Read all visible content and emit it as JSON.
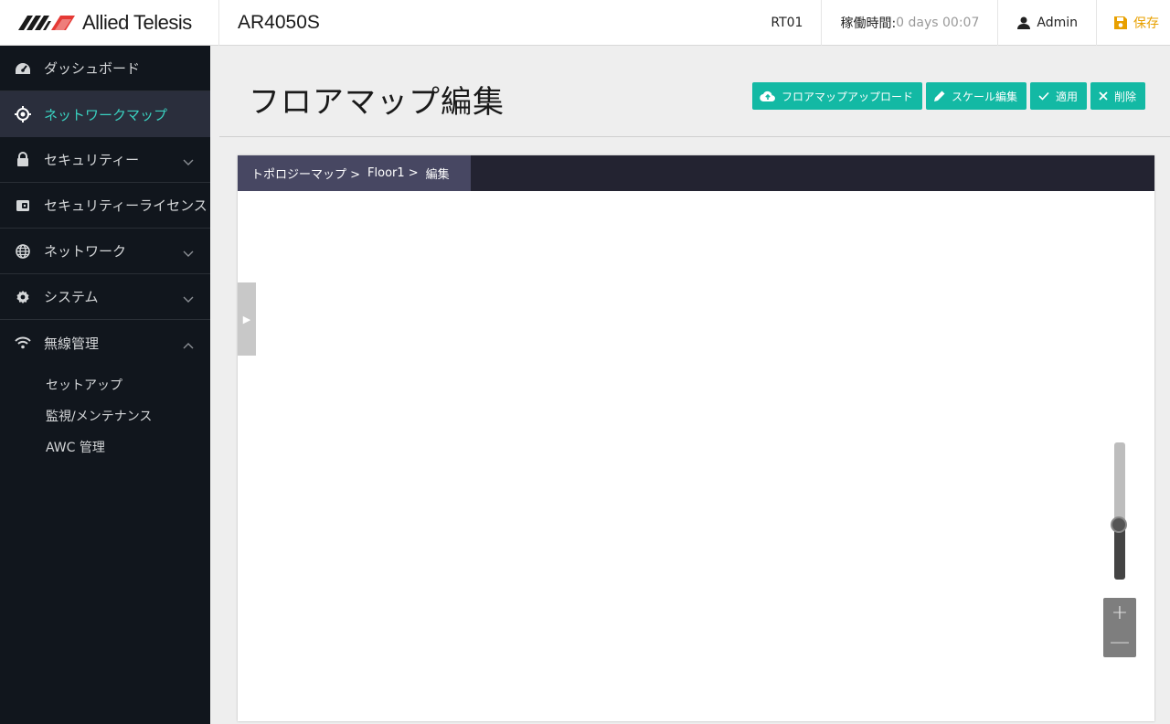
{
  "header": {
    "logo_text": "Allied Telesis",
    "model": "AR4050S",
    "hostname": "RT01",
    "uptime_label": "稼働時間:",
    "uptime_value": "0 days 00:07",
    "user": "Admin",
    "save_label": "保存",
    "save_color": "#e8a000"
  },
  "sidebar": {
    "items": [
      {
        "label": "ダッシュボード",
        "icon": "dashboard-icon"
      },
      {
        "label": "ネットワークマップ",
        "icon": "network-map-icon",
        "active": true
      },
      {
        "label": "セキュリティー",
        "icon": "lock-icon",
        "expandable": true
      },
      {
        "label": "セキュリティーライセンス",
        "icon": "license-icon"
      },
      {
        "label": "ネットワーク",
        "icon": "globe-icon",
        "expandable": true
      },
      {
        "label": "システム",
        "icon": "gear-icon",
        "expandable": true
      },
      {
        "label": "無線管理",
        "icon": "wifi-icon",
        "expanded": true
      }
    ],
    "subitems": [
      {
        "label": "セットアップ"
      },
      {
        "label": "監視/メンテナンス"
      },
      {
        "label": "AWC 管理"
      }
    ]
  },
  "main": {
    "title": "フロアマップ編集",
    "actions": [
      {
        "label": "フロアマップアップロード",
        "icon": "cloud-upload-icon"
      },
      {
        "label": "スケール編集",
        "icon": "pencil-icon"
      },
      {
        "label": "適用",
        "icon": "check-icon"
      },
      {
        "label": "削除",
        "icon": "close-icon"
      }
    ],
    "breadcrumb": [
      "トポロジーマップ >",
      "Floor1 >",
      "編集"
    ],
    "side_toggle": "▶",
    "zoom_in": "+",
    "zoom_out": "—",
    "zoom_level_fraction": 0.6
  },
  "colors": {
    "accent": "#13b9a4",
    "active_text": "#3ad1c0",
    "sidebar_bg": "#11161d",
    "breadcrumb_bg": "#232331"
  }
}
